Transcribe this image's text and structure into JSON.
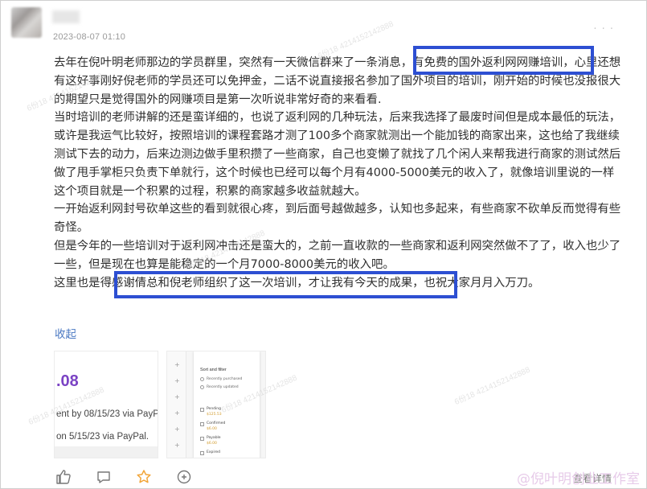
{
  "post": {
    "timestamp": "2023-08-07 01:10",
    "paragraphs": [
      "去年在倪叶明老师那边的学员群里，突然有一天微信群来了一条消息，有免费的国外返利网网赚培训，心里还想有这好事刚好倪老师的学员还可以免押金，二话不说直接报名参加了国外项目的培训，刚开始的时候也没报很大的期望只是觉得国外的网赚项目是第一次听说非常好奇的来看看.",
      "当时培训的老师讲解的还是蛮详细的，也说了返利网的几种玩法，后来我选择了最废时间但是成本最低的玩法，或许是我运气比较好，按照培训的课程套路才测了100多个商家就测出一个能加钱的商家出来，这也给了我继续测试下去的动力，后来边测边做手里积攒了一些商家，自己也变懒了就找了几个闲人来帮我进行商家的测试然后做了甩手掌柜只负责下单就行，这个时候也已经可以每个月有4000-5000美元的收入了，就像培训里说的一样这个项目就是一个积累的过程，积累的商家越多收益就越大。",
      "一开始返利网封号砍单这些的看到就很心疼，到后面号越做越多，认知也多起来，有些商家不砍单反而觉得有些奇怪。",
      "但是今年的一些培训对于返利网冲击还是蛮大的，之前一直收款的一些商家和返利网突然做不了了，收入也少了一些，但是现在也算是能稳定的一个月7000-8000美元的收入吧。",
      "这里也是得感谢倩总和倪老师组织了这一次培训，才让我有今天的成果，也祝大家月月入万刀。"
    ],
    "collapse_label": "收起"
  },
  "images": {
    "thumb1": {
      "amount": ".08",
      "line1": "ent by 08/15/23 via PayP",
      "line2": "on 5/15/23 via PayPal."
    },
    "thumb2": {
      "title": "Sort and filter",
      "options": [
        "Recently purchased",
        "Recently updated"
      ],
      "rows": [
        {
          "label": "Pending",
          "amount": "$125.53"
        },
        {
          "label": "Confirmed",
          "amount": "$6.00"
        },
        {
          "label": "Payable",
          "amount": "$6.00"
        },
        {
          "label": "Expired",
          "amount": ""
        }
      ]
    }
  },
  "footer": {
    "view_detail": "查看详情",
    "watermark_text": "@倪叶明创业工作室"
  },
  "diagonal_watermark": "6份18 4214152142888",
  "colors": {
    "highlight": "#2d4fd2",
    "link": "#4a78c2",
    "star": "#f2a63a"
  }
}
